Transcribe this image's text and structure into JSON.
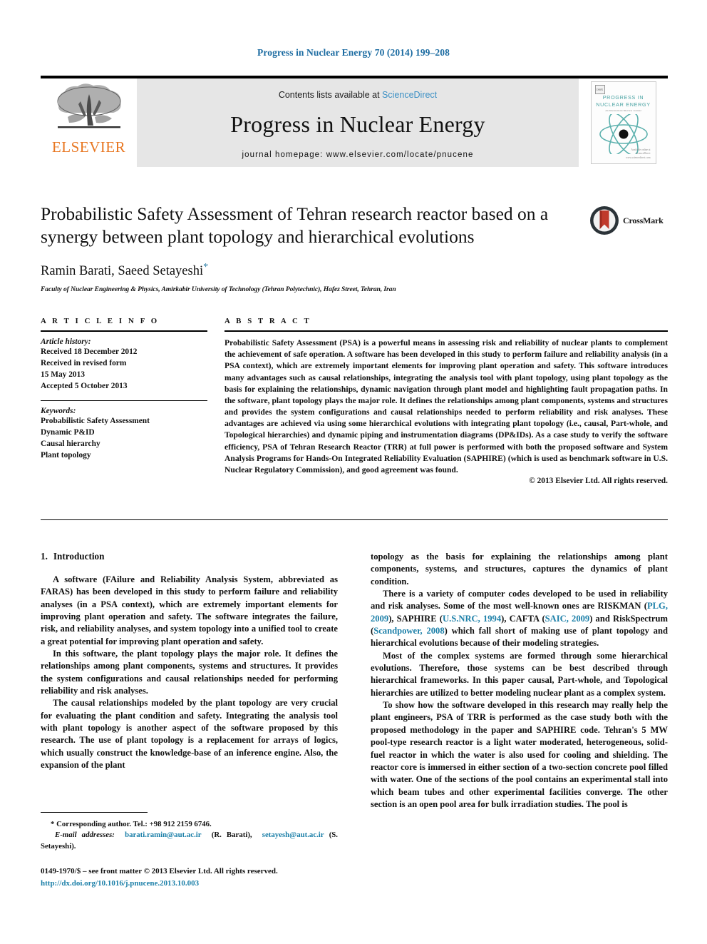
{
  "running_head": "Progress in Nuclear Energy 70 (2014) 199–208",
  "masthead": {
    "publisher_name": "ELSEVIER",
    "publisher_logo_icon": "elsevier-tree-icon",
    "contents_prefix": "Contents lists available at ",
    "contents_link": "ScienceDirect",
    "journal_name": "Progress in Nuclear Energy",
    "homepage": "journal homepage: www.elsevier.com/locate/pnucene",
    "cover": {
      "badge": "ISSN",
      "title_line1": "PROGRESS IN",
      "title_line2": "NUCLEAR ENERGY",
      "subtitle": "An International Review Journal",
      "atom_icon": "atom-icon",
      "footer_line1": "Available online at",
      "footer_line2": "ScienceDirect",
      "footer_line3": "www.sciencedirect.com"
    }
  },
  "article": {
    "title": "Probabilistic Safety Assessment of Tehran research reactor based on a synergy between plant topology and hierarchical evolutions",
    "crossmark_label": "CrossMark",
    "crossmark_icon": "crossmark-icon",
    "authors": "Ramin Barati, Saeed Setayeshi",
    "corresponding_marker": "*",
    "affiliation": "Faculty of Nuclear Engineering & Physics, Amirkabir University of Technology (Tehran Polytechnic), Hafez Street, Tehran, Iran"
  },
  "article_info": {
    "heading": "A R T I C L E   I N F O",
    "history_label": "Article history:",
    "history": [
      "Received 18 December 2012",
      "Received in revised form",
      "15 May 2013",
      "Accepted 5 October 2013"
    ],
    "keywords_label": "Keywords:",
    "keywords": [
      "Probabilistic Safety Assessment",
      "Dynamic P&ID",
      "Causal hierarchy",
      "Plant topology"
    ]
  },
  "abstract": {
    "heading": "A B S T R A C T",
    "text": "Probabilistic Safety Assessment (PSA) is a powerful means in assessing risk and reliability of nuclear plants to complement the achievement of safe operation. A software has been developed in this study to perform failure and reliability analysis (in a PSA context), which are extremely important elements for improving plant operation and safety. This software introduces many advantages such as causal relationships, integrating the analysis tool with plant topology, using plant topology as the basis for explaining the relationships, dynamic navigation through plant model and highlighting fault propagation paths. In the software, plant topology plays the major role. It defines the relationships among plant components, systems and structures and provides the system configurations and causal relationships needed to perform reliability and risk analyses. These advantages are achieved via using some hierarchical evolutions with integrating plant topology (i.e., causal, Part-whole, and Topological hierarchies) and dynamic piping and instrumentation diagrams (DP&IDs). As a case study to verify the software efficiency, PSA of Tehran Research Reactor (TRR) at full power is performed with both the proposed software and System Analysis Programs for Hands-On Integrated Reliability Evaluation (SAPHIRE) (which is used as benchmark software in U.S. Nuclear Regulatory Commission), and good agreement was found.",
    "copyright": "© 2013 Elsevier Ltd. All rights reserved."
  },
  "body": {
    "section_number": "1.",
    "section_title": "Introduction",
    "left_paragraphs": [
      "A software (FAilure and Reliability Analysis System, abbreviated as FARAS) has been developed in this study to perform failure and reliability analyses (in a PSA context), which are extremely important elements for improving plant operation and safety. The software integrates the failure, risk, and reliability analyses, and system topology into a unified tool to create a great potential for improving plant operation and safety.",
      "In this software, the plant topology plays the major role. It defines the relationships among plant components, systems and structures. It provides the system configurations and causal relationships needed for performing reliability and risk analyses.",
      "The causal relationships modeled by the plant topology are very crucial for evaluating the plant condition and safety. Integrating the analysis tool with plant topology is another aspect of the software proposed by this research. The use of plant topology is a replacement for arrays of logics, which usually construct the knowledge-base of an inference engine. Also, the expansion of the plant"
    ],
    "right_paragraph_1": "topology as the basis for explaining the relationships among plant components, systems, and structures, captures the dynamics of plant condition.",
    "right_paragraph_2_parts": {
      "pre": "There is a variety of computer codes developed to be used in reliability and risk analyses. Some of the most well-known ones are RISKMAN (",
      "cite1": "PLG, 2009",
      "mid1": "), SAPHIRE (",
      "cite2": "U.S.NRC, 1994",
      "mid2": "), CAFTA (",
      "cite3": "SAIC, 2009",
      "mid3": ") and RiskSpectrum (",
      "cite4": "Scandpower, 2008",
      "post": ") which fall short of making use of plant topology and hierarchical evolutions because of their modeling strategies."
    },
    "right_paragraph_3": "Most of the complex systems are formed through some hierarchical evolutions. Therefore, those systems can be best described through hierarchical frameworks. In this paper causal, Part-whole, and Topological hierarchies are utilized to better modeling nuclear plant as a complex system.",
    "right_paragraph_4": "To show how the software developed in this research may really help the plant engineers, PSA of TRR is performed as the case study both with the proposed methodology in the paper and SAPHIRE code. Tehran's 5 MW pool-type research reactor is a light water moderated, heterogeneous, solid-fuel reactor in which the water is also used for cooling and shielding. The reactor core is immersed in either section of a two-section concrete pool filled with water. One of the sections of the pool contains an experimental stall into which beam tubes and other experimental facilities converge. The other section is an open pool area for bulk irradiation studies. The pool is"
  },
  "footnotes": {
    "corresponding": "* Corresponding author. Tel.: +98 912 2159 6746.",
    "email_label": "E-mail addresses:",
    "email1": "barati.ramin@aut.ac.ir",
    "email1_owner": "(R. Barati),",
    "email2": "setayesh@aut.ac.ir",
    "email2_owner": "(S. Setayeshi).",
    "imprint": "0149-1970/$ – see front matter © 2013 Elsevier Ltd. All rights reserved.",
    "doi": "http://dx.doi.org/10.1016/j.pnucene.2013.10.003"
  },
  "colors": {
    "link": "#1b7fa8",
    "running_head": "#1b6ba1",
    "elsevier_orange": "#E87722",
    "cover_teal": "#4aa3a3",
    "crossmark_red": "#c0392b"
  }
}
